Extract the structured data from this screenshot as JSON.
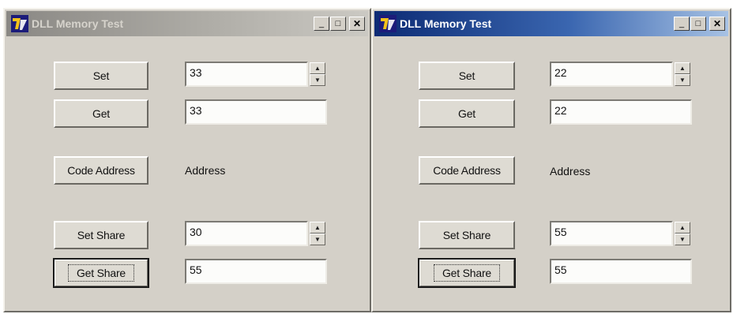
{
  "windows": [
    {
      "title": "DLL Memory Test",
      "controls": {
        "minimize": "_",
        "maximize": "□",
        "close": "✕"
      },
      "set_button": "Set",
      "set_value": "33",
      "get_button": "Get",
      "get_value": "33",
      "code_address_button": "Code Address",
      "address_label": "Address",
      "set_share_button": "Set Share",
      "set_share_value": "30",
      "get_share_button": "Get Share",
      "get_share_value": "55",
      "spin_up": "▲",
      "spin_down": "▼"
    },
    {
      "title": "DLL Memory Test",
      "controls": {
        "minimize": "_",
        "maximize": "□",
        "close": "✕"
      },
      "set_button": "Set",
      "set_value": "22",
      "get_button": "Get",
      "get_value": "22",
      "code_address_button": "Code Address",
      "address_label": "Address",
      "set_share_button": "Set Share",
      "set_share_value": "55",
      "get_share_button": "Get Share",
      "get_share_value": "55",
      "spin_up": "▲",
      "spin_down": "▼"
    }
  ]
}
